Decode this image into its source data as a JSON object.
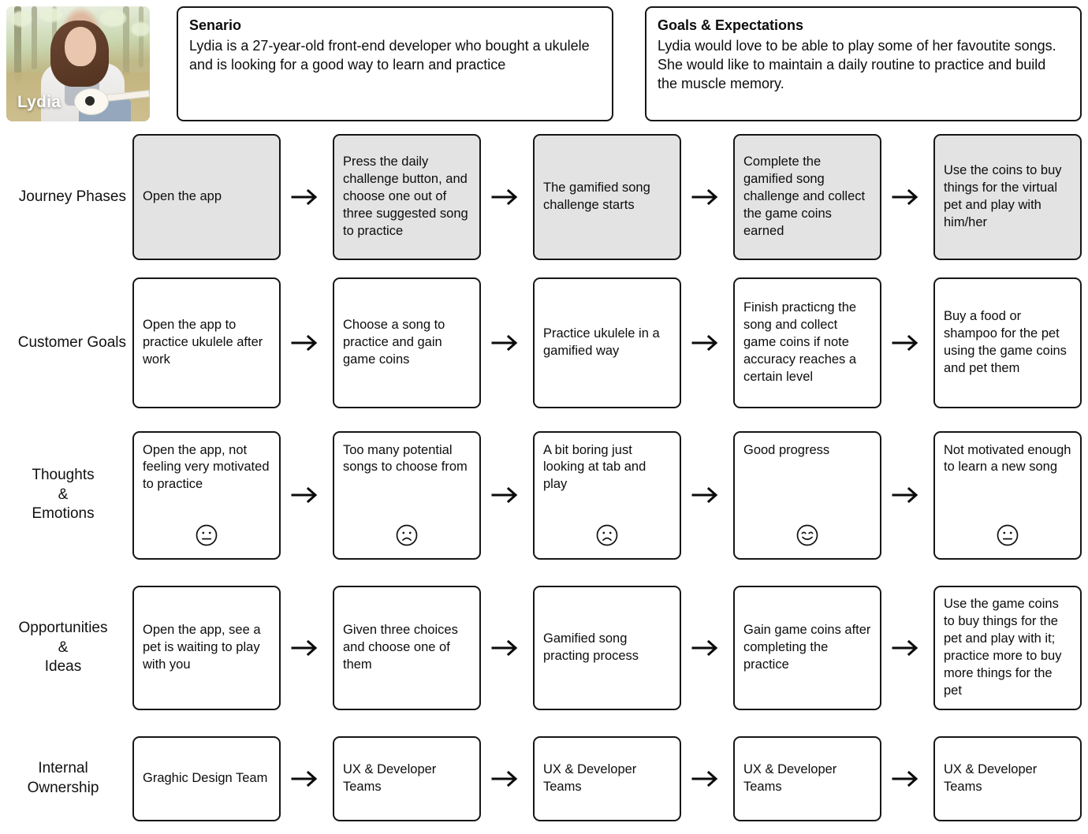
{
  "persona": {
    "name": "Lydia",
    "photo_alt": "woman sitting in a park playing a ukulele"
  },
  "scenario": {
    "title": "Senario",
    "body": "Lydia is a 27-year-old front-end developer who bought a ukulele and is looking for a good way to learn and practice"
  },
  "goals": {
    "title": "Goals & Expectations",
    "body": "Lydia would love to be able to play some of her favoutite songs. She would like to maintain a daily routine to practice and build the muscle memory."
  },
  "colors": {
    "border": "#161616",
    "shaded_cell": "#e3e3e3",
    "page_background": "#ffffff",
    "text": "#0d0d0d"
  },
  "rows": [
    {
      "label": "Journey Phases",
      "label_align": "right",
      "shaded": true,
      "text_align": "center",
      "cells": [
        {
          "text": "Open the app"
        },
        {
          "text": "Press the daily challenge button, and choose one out of three suggested song to practice"
        },
        {
          "text": "The gamified song challenge starts"
        },
        {
          "text": "Complete the gamified song challenge and collect the game coins earned"
        },
        {
          "text": "Use the coins to buy things for the virtual pet and play with him/her"
        }
      ]
    },
    {
      "label": "Customer Goals",
      "label_align": "right",
      "shaded": false,
      "text_align": "center",
      "cells": [
        {
          "text": "Open the app to practice ukulele after work"
        },
        {
          "text": "Choose a song to practice and gain game coins"
        },
        {
          "text": "Practice ukulele in a gamified way"
        },
        {
          "text": "Finish practicng the song and collect game coins if note accuracy reaches a certain level"
        },
        {
          "text": "Buy a food or shampoo for the pet using the game coins and pet them"
        }
      ]
    },
    {
      "label": "Thoughts\n&\nEmotions",
      "label_align": "center",
      "shaded": false,
      "text_align": "top",
      "cells": [
        {
          "text": "Open the app, not feeling very motivated to practice",
          "emotion": "neutral-face-icon"
        },
        {
          "text": "Too many potential songs to choose from",
          "emotion": "sad-face-icon"
        },
        {
          "text": "A bit boring just looking at tab and play",
          "emotion": "sad-face-icon"
        },
        {
          "text": "Good progress",
          "emotion": "happy-face-icon"
        },
        {
          "text": "Not motivated enough to learn a new song",
          "emotion": "neutral-face-icon"
        }
      ]
    },
    {
      "label": "Opportunities\n&\nIdeas",
      "label_align": "center",
      "shaded": false,
      "text_align": "center",
      "cells": [
        {
          "text": "Open the app, see a pet is waiting to play with you"
        },
        {
          "text": "Given three choices and choose one of them"
        },
        {
          "text": "Gamified song practing process"
        },
        {
          "text": "Gain game coins after completing the practice"
        },
        {
          "text": "Use the game coins to buy things for the pet and play with it; practice more to buy more things for the pet"
        }
      ]
    },
    {
      "label": "Internal\nOwnership",
      "label_align": "center",
      "shaded": false,
      "text_align": "center",
      "cells": [
        {
          "text": "Graghic Design Team"
        },
        {
          "text": "UX & Developer Teams"
        },
        {
          "text": "UX & Developer Teams"
        },
        {
          "text": "UX & Developer Teams"
        },
        {
          "text": "UX & Developer Teams"
        }
      ]
    }
  ],
  "arrow_icon": "arrow-right-icon"
}
